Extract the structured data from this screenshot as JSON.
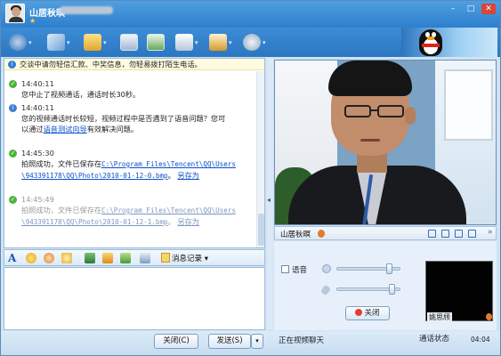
{
  "window": {
    "title": "山居秋暝",
    "controls": {
      "minimize": "–",
      "maximize": "□",
      "close": "✕"
    }
  },
  "toolbar": {
    "icons": [
      "video-call-icon",
      "apps-icon",
      "file-transfer-icon",
      "screen-share-icon",
      "meeting-icon",
      "favorites-icon",
      "settings-icon"
    ],
    "brand_icon": "qq-penguin-icon"
  },
  "chat": {
    "notice": "交谈中请勿轻信汇款、中奖信息，勿轻易拨打陌生电话。",
    "messages": [
      {
        "time": "14:40:11",
        "type": "ok",
        "text": "您中止了视频通话，通话时长30秒。"
      },
      {
        "time": "14:40:11",
        "type": "info",
        "text": "您的视频通话时长较短，视频过程中是否遇到了语音问题？您可",
        "text2_prefix": "以通过",
        "link": "语音测试向导",
        "text2_suffix": "有效解决问题。"
      },
      {
        "time": "14:45:30",
        "type": "ok",
        "text": "拍照成功，文件已保存在",
        "link": "C:\\Program Files\\Tencent\\QQ\\Users",
        "line2_link": "\\943391178\\QQ\\Photo\\2010-01-12-0.bmp",
        "line2_suffix": "。",
        "save_as": "另存为"
      },
      {
        "time": "14:45:49",
        "type": "ok",
        "text": "拍照成功，文件已保存在",
        "link": "C:\\Program Files\\Tencent\\QQ\\Users",
        "line2_link": "\\943391178\\QQ\\Photo\\2010-01-12-1.bmp",
        "line2_suffix": "。",
        "save_as": "另存为"
      }
    ]
  },
  "format_bar": {
    "font_label": "A",
    "icons": [
      "emoji-icon",
      "wink-icon",
      "magic-emoticon-icon",
      "image-icon",
      "screenshot-icon",
      "music-icon",
      "more-icon"
    ],
    "message_record": "消息记录 ▾"
  },
  "bottom": {
    "close_label": "关闭(C)",
    "send_label": "发送(S)",
    "send_arrow": "▾",
    "status_left": "正在视频聊天",
    "status_right": "通话状态",
    "timer": "04:04"
  },
  "video": {
    "peer_name": "山居秋暝",
    "expand": "»",
    "voice_label": "语音",
    "voice_checked": false,
    "speaker_volume": 0.88,
    "mic_volume": 0.92,
    "hangup_label": "关闭",
    "self_name": "姚思颀"
  },
  "colors": {
    "titlebar": "#2d7fcd",
    "link": "#0a50c8",
    "ok_icon": "#4db43a",
    "info_icon": "#3d7fd1"
  }
}
